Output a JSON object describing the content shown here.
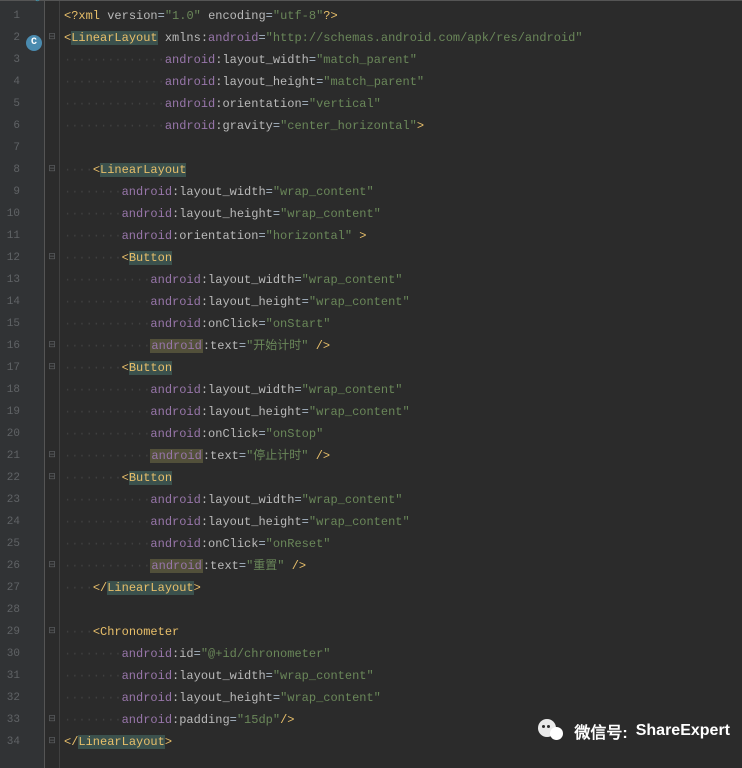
{
  "watermark": {
    "prefix": "微信号:",
    "id": "ShareExpert"
  },
  "gutter_icon": "C",
  "indent_guides": "····",
  "lines": [
    {
      "n": 1,
      "html": "<span class='punct'>&lt;?</span><span class='tag'>xml</span> <span class='attr-local'>version</span><span class='op'>=</span><span class='val'>\"1.0\"</span> <span class='attr-local'>encoding</span><span class='op'>=</span><span class='val'>\"utf-8\"</span><span class='punct'>?&gt;</span>"
    },
    {
      "n": 2,
      "fold": "⊟",
      "html": "<span class='punct'>&lt;</span><span class='tag-hl'>LinearLayout</span> <span class='attr-pre'>xmlns:</span><span class='attr-ns'>android</span><span class='op'>=</span><span class='val'>\"http://schemas.android.com/apk/res/android\"</span>"
    },
    {
      "n": 3,
      "html": "<span class='dots'>··············</span><span class='attr-ns'>android</span><span class='attr-local'>:layout_width</span><span class='op'>=</span><span class='val'>\"match_parent\"</span>"
    },
    {
      "n": 4,
      "html": "<span class='dots'>··············</span><span class='attr-ns'>android</span><span class='attr-local'>:layout_height</span><span class='op'>=</span><span class='val'>\"match_parent\"</span>"
    },
    {
      "n": 5,
      "html": "<span class='dots'>··············</span><span class='attr-ns'>android</span><span class='attr-local'>:orientation</span><span class='op'>=</span><span class='val'>\"vertical\"</span>"
    },
    {
      "n": 6,
      "html": "<span class='dots'>··············</span><span class='attr-ns'>android</span><span class='attr-local'>:gravity</span><span class='op'>=</span><span class='val'>\"center_horizontal\"</span><span class='punct'>&gt;</span>"
    },
    {
      "n": 7,
      "html": ""
    },
    {
      "n": 8,
      "fold": "⊟",
      "html": "<span class='dots'>····</span><span class='punct'>&lt;</span><span class='tag-hl'>LinearLayout</span>"
    },
    {
      "n": 9,
      "html": "<span class='dots'>········</span><span class='attr-ns'>android</span><span class='attr-local'>:layout_width</span><span class='op'>=</span><span class='val'>\"wrap_content\"</span>"
    },
    {
      "n": 10,
      "html": "<span class='dots'>········</span><span class='attr-ns'>android</span><span class='attr-local'>:layout_height</span><span class='op'>=</span><span class='val'>\"wrap_content\"</span>"
    },
    {
      "n": 11,
      "html": "<span class='dots'>········</span><span class='attr-ns'>android</span><span class='attr-local'>:orientation</span><span class='op'>=</span><span class='val'>\"horizontal\"</span> <span class='punct'>&gt;</span>"
    },
    {
      "n": 12,
      "fold": "⊟",
      "html": "<span class='dots'>········</span><span class='punct'>&lt;</span><span class='tag-hl'>Button</span>"
    },
    {
      "n": 13,
      "html": "<span class='dots'>············</span><span class='attr-ns'>android</span><span class='attr-local'>:layout_width</span><span class='op'>=</span><span class='val'>\"wrap_content\"</span>"
    },
    {
      "n": 14,
      "html": "<span class='dots'>············</span><span class='attr-ns'>android</span><span class='attr-local'>:layout_height</span><span class='op'>=</span><span class='val'>\"wrap_content\"</span>"
    },
    {
      "n": 15,
      "html": "<span class='dots'>············</span><span class='attr-ns'>android</span><span class='attr-local'>:onClick</span><span class='op'>=</span><span class='val'>\"</span><span class='val-warn'>onStart</span><span class='val'>\"</span>"
    },
    {
      "n": 16,
      "fold": "⊟",
      "html": "<span class='dots'>············</span><span class='attr-warn'>android</span><span class='attr-local'>:text</span><span class='op'>=</span><span class='val'>\"</span><span class='val-warn'>开始计时</span><span class='val'>\"</span> <span class='punct'>/&gt;</span>"
    },
    {
      "n": 17,
      "fold": "⊟",
      "html": "<span class='dots'>········</span><span class='punct'>&lt;</span><span class='tag-hl'>Button</span>"
    },
    {
      "n": 18,
      "html": "<span class='dots'>············</span><span class='attr-ns'>android</span><span class='attr-local'>:layout_width</span><span class='op'>=</span><span class='val'>\"wrap_content\"</span>"
    },
    {
      "n": 19,
      "html": "<span class='dots'>············</span><span class='attr-ns'>android</span><span class='attr-local'>:layout_height</span><span class='op'>=</span><span class='val'>\"wrap_content\"</span>"
    },
    {
      "n": 20,
      "html": "<span class='dots'>············</span><span class='attr-ns'>android</span><span class='attr-local'>:onClick</span><span class='op'>=</span><span class='val'>\"</span><span class='val-warn'>onStop</span><span class='val'>\"</span>"
    },
    {
      "n": 21,
      "fold": "⊟",
      "html": "<span class='dots'>············</span><span class='attr-warn'>android</span><span class='attr-local'>:text</span><span class='op'>=</span><span class='val'>\"</span><span class='val-warn'>停止计时</span><span class='val'>\"</span> <span class='punct'>/&gt;</span>"
    },
    {
      "n": 22,
      "fold": "⊟",
      "html": "<span class='dots'>········</span><span class='punct'>&lt;</span><span class='tag-hl'>Button</span>"
    },
    {
      "n": 23,
      "html": "<span class='dots'>············</span><span class='attr-ns'>android</span><span class='attr-local'>:layout_width</span><span class='op'>=</span><span class='val'>\"wrap_content\"</span>"
    },
    {
      "n": 24,
      "html": "<span class='dots'>············</span><span class='attr-ns'>android</span><span class='attr-local'>:layout_height</span><span class='op'>=</span><span class='val'>\"wrap_content\"</span>"
    },
    {
      "n": 25,
      "html": "<span class='dots'>············</span><span class='attr-ns'>android</span><span class='attr-local'>:onClick</span><span class='op'>=</span><span class='val'>\"</span><span class='val-warn'>onReset</span><span class='val'>\"</span>"
    },
    {
      "n": 26,
      "fold": "⊟",
      "html": "<span class='dots'>············</span><span class='attr-warn'>android</span><span class='attr-local'>:text</span><span class='op'>=</span><span class='val'>\"</span><span class='val-warn'>重置</span><span class='val'>\"</span> <span class='punct'>/&gt;</span>"
    },
    {
      "n": 27,
      "html": "<span class='dots'>····</span><span class='punct'>&lt;/</span><span class='tag-hl'>LinearLayout</span><span class='punct'>&gt;</span>"
    },
    {
      "n": 28,
      "html": ""
    },
    {
      "n": 29,
      "fold": "⊟",
      "html": "<span class='dots'>····</span><span class='punct'>&lt;</span><span class='tag'>Chronometer</span>"
    },
    {
      "n": 30,
      "html": "<span class='dots'>········</span><span class='attr-ns'>android</span><span class='attr-local'>:id</span><span class='op'>=</span><span class='val'>\"@+id/chronometer\"</span>"
    },
    {
      "n": 31,
      "html": "<span class='dots'>········</span><span class='attr-ns'>android</span><span class='attr-local'>:layout_width</span><span class='op'>=</span><span class='val'>\"wrap_content\"</span>"
    },
    {
      "n": 32,
      "html": "<span class='dots'>········</span><span class='attr-ns'>android</span><span class='attr-local'>:layout_height</span><span class='op'>=</span><span class='val'>\"wrap_content\"</span>"
    },
    {
      "n": 33,
      "fold": "⊟",
      "html": "<span class='dots'>········</span><span class='attr-ns'>android</span><span class='attr-local'>:padding</span><span class='op'>=</span><span class='val'>\"</span><span class='val-warn'>15dp</span><span class='val'>\"</span><span class='punct'>/&gt;</span>"
    },
    {
      "n": 34,
      "fold": "⊟",
      "html": "<span class='punct'>&lt;/</span><span class='tag-hl'>LinearLayout</span><span class='punct'>&gt;</span>"
    }
  ]
}
